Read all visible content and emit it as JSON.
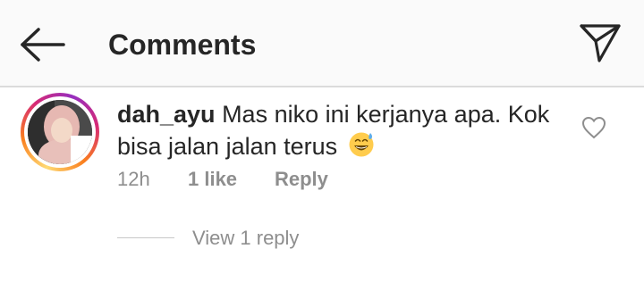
{
  "header": {
    "back_icon": "arrow-left-icon",
    "title": "Comments",
    "send_icon": "paper-plane-icon"
  },
  "comment": {
    "username": "dah_ayu",
    "text": "Mas niko ini kerjanya apa. Kok bisa jalan jalan terus",
    "emoji": "grinning-face-with-sweat-icon",
    "time": "12h",
    "likes": "1 like",
    "reply_label": "Reply",
    "view_replies": "View 1 reply",
    "like_icon": "heart-outline-icon"
  },
  "colors": {
    "text": "#262626",
    "secondary": "#8e8e8e",
    "header_bg": "#fafafa",
    "story_ring": [
      "#feda75",
      "#fa7e1e",
      "#d62976",
      "#962fbf"
    ]
  }
}
